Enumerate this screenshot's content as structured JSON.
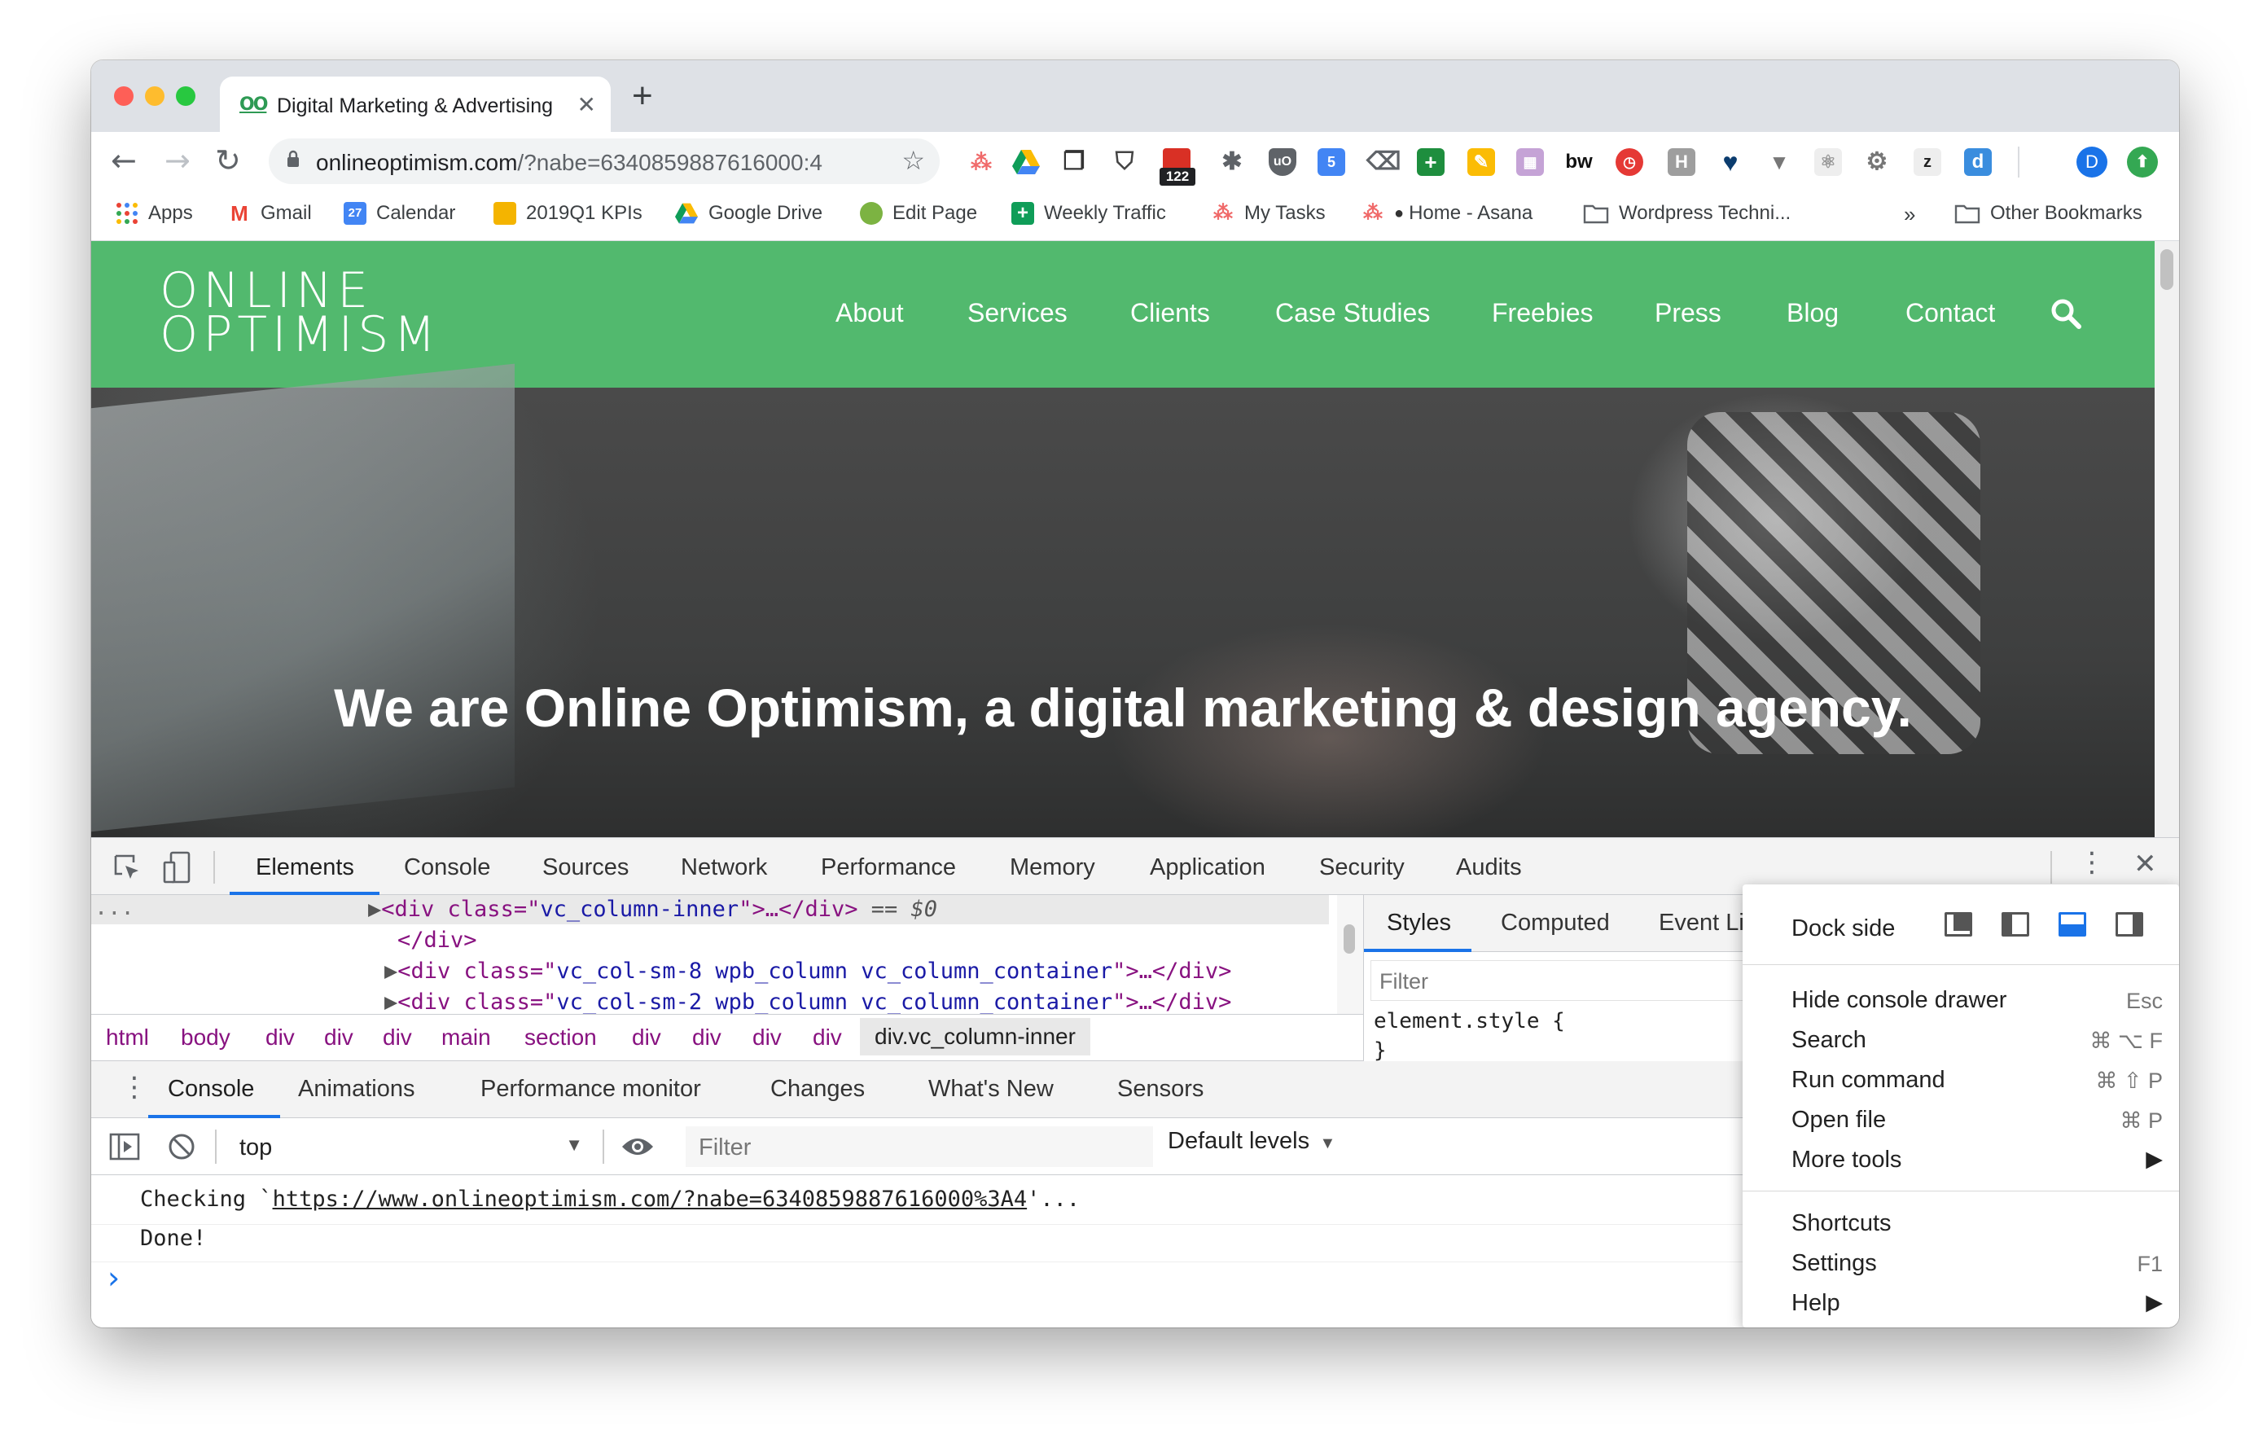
{
  "browser": {
    "tab_title": "Digital Marketing & Advertising",
    "tab_favicon": "OO",
    "url_host": "onlineoptimism.com",
    "url_query": "/?nabe=6340859887616000:4",
    "extension_badge": "122",
    "avatar_letter": "D"
  },
  "bookmarks": [
    {
      "label": "Apps",
      "icon": "apps-grid-icon"
    },
    {
      "label": "Gmail",
      "icon": "gmail-icon"
    },
    {
      "label": "Calendar",
      "icon": "calendar-icon",
      "glyph": "27"
    },
    {
      "label": "2019Q1 KPIs",
      "icon": "slides-icon"
    },
    {
      "label": "Google Drive",
      "icon": "drive-icon"
    },
    {
      "label": "Edit Page",
      "icon": "edit-page-icon"
    },
    {
      "label": "Weekly Traffic",
      "icon": "sheets-plus-icon"
    },
    {
      "label": "My Tasks",
      "icon": "asana-icon"
    },
    {
      "label": "Home - Asana",
      "icon": "asana-icon"
    },
    {
      "label": "Wordpress Techni...",
      "icon": "folder-icon"
    },
    {
      "label": "»",
      "icon": "overflow-chevron"
    },
    {
      "label": "Other Bookmarks",
      "icon": "folder-icon"
    }
  ],
  "site": {
    "logo_line1": "ONLINE",
    "logo_line2": "OPTIMISM",
    "nav": [
      "About",
      "Services",
      "Clients",
      "Case Studies",
      "Freebies",
      "Press",
      "Blog",
      "Contact"
    ],
    "hero_heading": "We are Online Optimism, a digital marketing & design agency.",
    "brand_color": "#52b96e"
  },
  "devtools": {
    "tabs": [
      "Elements",
      "Console",
      "Sources",
      "Network",
      "Performance",
      "Memory",
      "Application",
      "Security",
      "Audits"
    ],
    "active_tab": "Elements",
    "ellipsis": "...",
    "code": {
      "l1_open": "<div class=\"",
      "l1_class": "vc_column-inner",
      "l1_close": "\">…</div>",
      "l1_ref": "== $0",
      "l2": "</div>",
      "l3_class": "vc_col-sm-8 wpb_column vc_column_container",
      "l4_class": "vc_col-sm-2 wpb_column vc_column_container",
      "row_open": "<div class=\"",
      "row_close": "\">…</div>"
    },
    "breadcrumbs": [
      "html",
      "body",
      "div",
      "div",
      "div",
      "main",
      "section",
      "div",
      "div",
      "div",
      "div",
      "div.vc_column-inner"
    ],
    "styles_tabs": [
      "Styles",
      "Computed",
      "Event Lis"
    ],
    "styles_filter_placeholder": "Filter",
    "styles_rule": "element.style {",
    "styles_rule_end": "}",
    "drawer_tabs": [
      "Console",
      "Animations",
      "Performance monitor",
      "Changes",
      "What's New",
      "Sensors"
    ],
    "context": "top",
    "console_filter_placeholder": "Filter",
    "levels": "Default levels",
    "console_lines": {
      "line1_prefix": "Checking `",
      "line1_link": "https://www.onlineoptimism.com/?nabe=6340859887616000%3A4",
      "line1_suffix": "'...",
      "line2": "Done!"
    },
    "prompt": "›"
  },
  "menu": {
    "dock_label": "Dock side",
    "items": [
      {
        "label": "Hide console drawer",
        "shortcut": "Esc"
      },
      {
        "label": "Search",
        "shortcut": "⌘ ⌥ F"
      },
      {
        "label": "Run command",
        "shortcut": "⌘ ⇧ P"
      },
      {
        "label": "Open file",
        "shortcut": "⌘ P"
      },
      {
        "label": "More tools",
        "shortcut": "▶"
      },
      {
        "label": "Shortcuts",
        "shortcut": ""
      },
      {
        "label": "Settings",
        "shortcut": "F1"
      },
      {
        "label": "Help",
        "shortcut": "▶"
      }
    ]
  }
}
